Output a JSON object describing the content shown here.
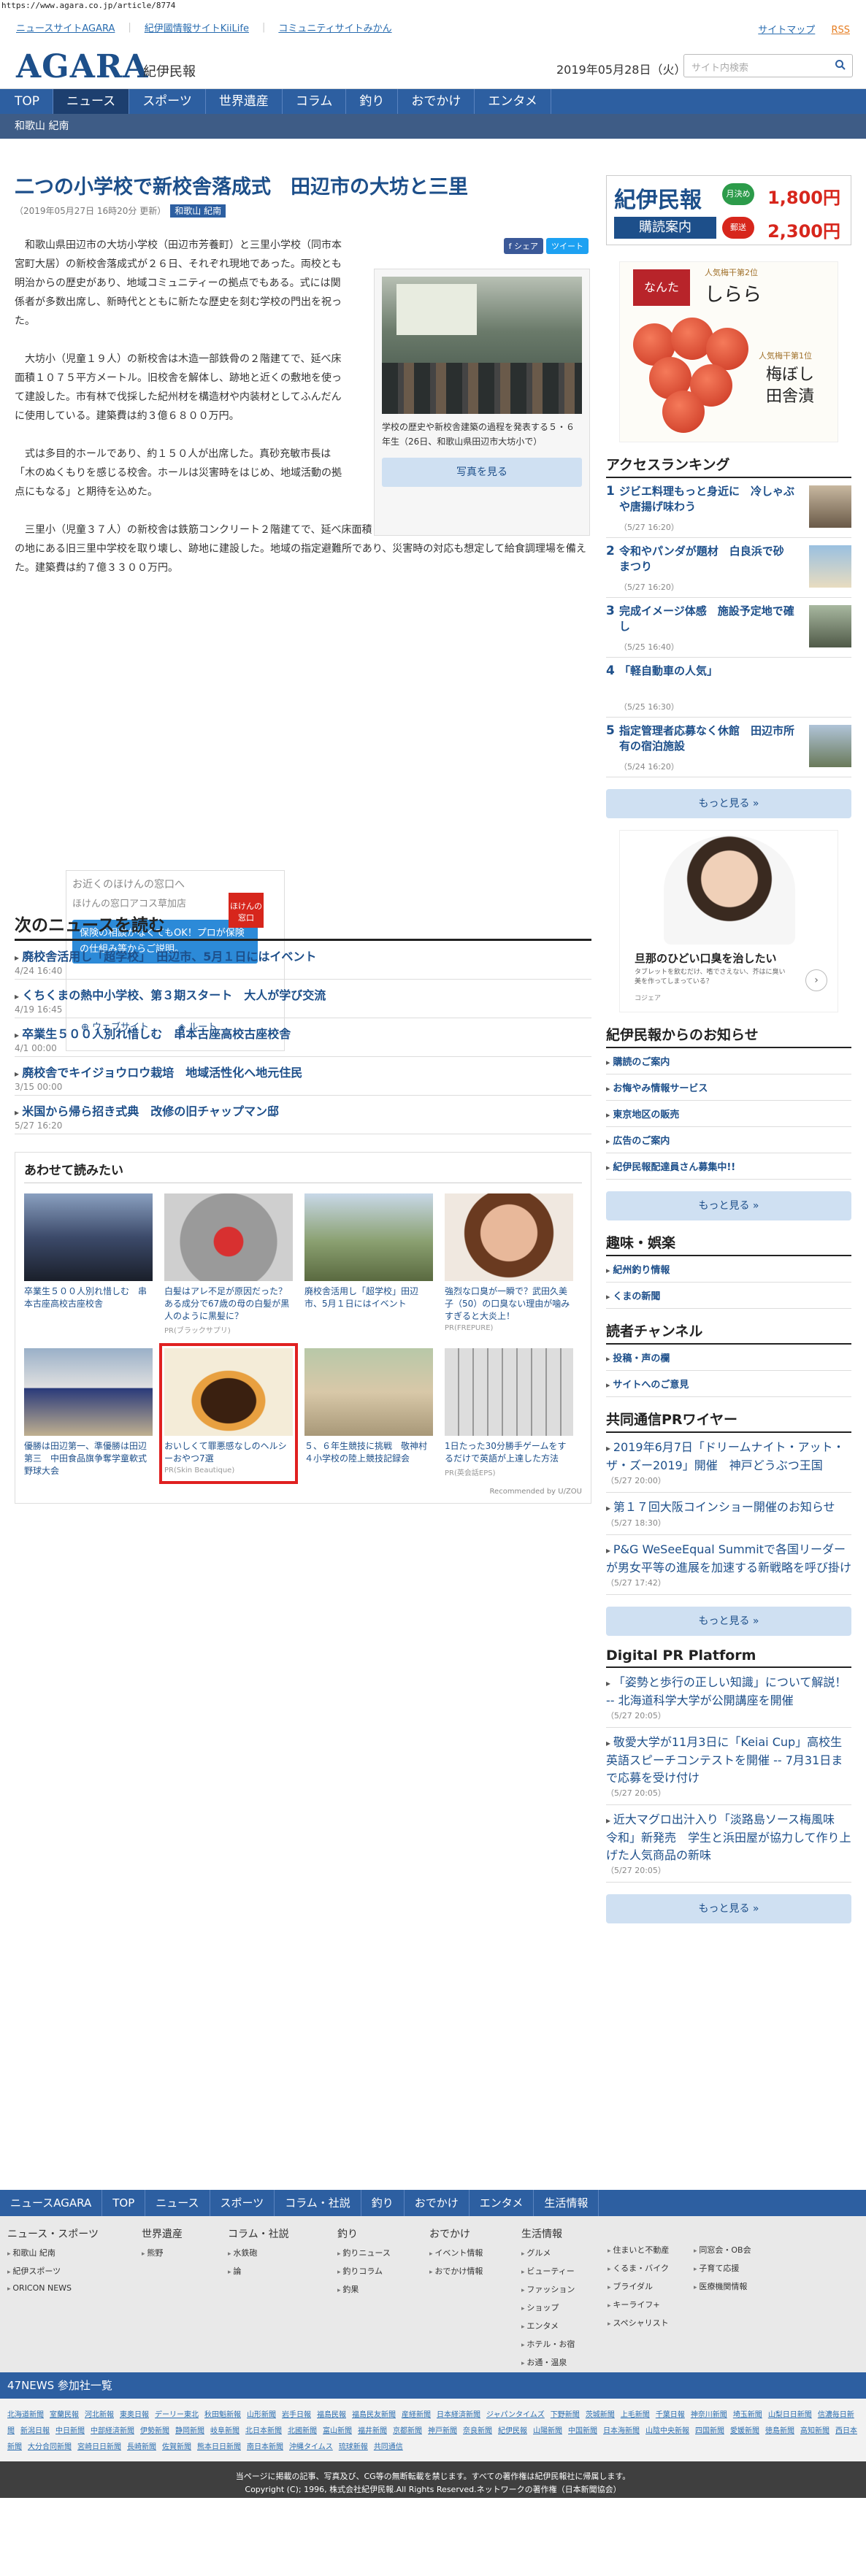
{
  "url": "https://www.agara.co.jp/article/8774",
  "toplinks": {
    "left": [
      "ニュースサイトAGARA",
      "紀伊國情報サイトKiiLife",
      "コミュニティサイトみかん"
    ],
    "sitemap": "サイトマップ",
    "rss": "RSS"
  },
  "header": {
    "logo": "AGARA",
    "logo_sub": "紀伊民報",
    "date": "2019年05月28日（火）",
    "search_placeholder": "サイト内検索"
  },
  "nav": [
    "TOP",
    "ニュース",
    "スポーツ",
    "世界遺産",
    "コラム",
    "釣り",
    "おでかけ",
    "エンタメ"
  ],
  "subnav": "和歌山 紀南",
  "article": {
    "title": "二つの小学校で新校舎落成式　田辺市の大坊と三里",
    "meta": "（2019年05月27日 16時20分 更新）",
    "category": "和歌山 紀南",
    "share": [
      "f シェア",
      "ツイート"
    ],
    "photo_caption": "学校の歴史や新校舎建築の過程を発表する５・６年生（26日、和歌山県田辺市大坊小で）",
    "photo_button": "写真を見る",
    "paragraphs": [
      "和歌山県田辺市の大坊小学校（田辺市芳養町）と三里小学校（同市本宮町大居）の新校舎落成式が２６日、それぞれ現地であった。両校とも明治からの歴史があり、地域コミュニティーの拠点でもある。式には関係者が多数出席し、新時代とともに新たな歴史を刻む学校の門出を祝った。",
      "大坊小（児童１９人）の新校舎は木造一部鉄骨の２階建てで、延べ床面積１０７５平方メートル。旧校舎を解体し、跡地と近くの敷地を使って建設した。市有林で伐採した紀州材を構造材や内装材としてふんだんに使用している。建築費は約３億６８００万円。",
      "式は多目的ホールであり、約１５０人が出席した。真砂充敏市長は「木のぬくもりを感じる校舎。ホールは災害時をはじめ、地域活動の拠点にもなる」と期待を込めた。",
      "三里小（児童３７人）の新校舎は鉄筋コンクリート２階建てで、延べ床面積２２０９平方メートル。標高約１００メートルの地にある旧三里中学校を取り壊し、跡地に建設した。地域の指定避難所であり、災害時の対応も想定して給食調理場を備えた。建築費は約７億３３００万円。"
    ]
  },
  "ad1": {
    "line1": "お近くのほけんの窓口へ",
    "line2": "ほけんの窓口アコス草加店",
    "logo": "ほけんの窓口",
    "blue": "保険の相談がなくてもOK！プロが保険の仕組み等からご説明。",
    "actions": [
      "ウェブサイト",
      "ルート"
    ]
  },
  "next": {
    "heading": "次のニュースを読む",
    "items": [
      {
        "title": "廃校舎活用し「超学校」　田辺市、5月１日にはイベント",
        "date": "4/24 16:40"
      },
      {
        "title": "くちくまの熱中小学校、第３期スタート　大人が学び交流",
        "date": "4/19 16:45"
      },
      {
        "title": "卒業生５００人別れ惜しむ　串本古座高校古座校舎",
        "date": "4/1 00:00"
      },
      {
        "title": "廃校舎でキイジョウロウ栽培　地域活性化へ地元住民",
        "date": "3/15 00:00"
      },
      {
        "title": "米国から帰ら招き式典　改修の旧チャップマン邸",
        "date": "5/27 16:20"
      }
    ]
  },
  "related": {
    "heading": "あわせて読みたい",
    "cards": [
      {
        "title": "卒業生５００人別れ惜しむ　串本古座高校古座校舎",
        "pr": ""
      },
      {
        "title": "白髪はアレ不足が原因だった？ある成分で67歳の母の白髪が黒人のように黒髪に？",
        "pr": "PR(ブラックサプリ)"
      },
      {
        "title": "廃校舎活用し「超学校」田辺市、5月１日にはイベント",
        "pr": ""
      },
      {
        "title": "強烈な口臭が一瞬で？武田久美子（50）の口臭ない理由が噛みすぎると大炎上！",
        "pr": "PR(FREPURE)"
      },
      {
        "title": "優勝は田辺第一、準優勝は田辺第三　中田食品旗争奪学童軟式野球大会",
        "pr": ""
      },
      {
        "title": "おいしくて罪悪感なしのヘルシーおやつ7選",
        "pr": "PR(Skin Beautique)"
      },
      {
        "title": "５、６年生競技に挑戦　敬神村４小学校の陸上競技記録会",
        "pr": ""
      },
      {
        "title": "1日たった30分勝手ゲームをするだけで英語が上達した方法",
        "pr": "PR(英会話EPS)"
      }
    ],
    "recommended": "Recommended by U/ZOU"
  },
  "side": {
    "banner": {
      "title": "紀伊民報",
      "sub": "購読案内",
      "b1": "月決め",
      "p1": "1,800円",
      "b2": "郵送",
      "p2": "2,300円"
    },
    "ume": {
      "brand": "なんた",
      "title": "しらら",
      "rank": "人気梅干第2位",
      "rank2": "人気梅干第1位",
      "name": "梅ぼし 田舎漬"
    },
    "ranking_heading": "アクセスランキング",
    "ranking": [
      {
        "n": "1",
        "title": "ジビエ料理もっと身近に　冷しゃぶや唐揚げ味わう",
        "date": "（5/27 16:20）"
      },
      {
        "n": "2",
        "title": "令和やパンダが題材　白良浜で砂まつり",
        "date": "（5/27 16:20）"
      },
      {
        "n": "3",
        "title": "完成イメージ体感　施設予定地で確し",
        "date": "（5/25 16:40）"
      },
      {
        "n": "4",
        "title": "「軽自動車の人気」",
        "date": "（5/25 16:30）"
      },
      {
        "n": "5",
        "title": "指定管理者応募なく休館　田辺市所有の宿泊施設",
        "date": "（5/24 16:20）"
      }
    ],
    "more": "もっと見る »",
    "ad2": {
      "line1": "旦那のひどい口臭を治したい",
      "line2": "タブレットを飲むだけ、嗜でさえない、芥はに臭い美を作ってしまっている？",
      "src": "コジェア"
    },
    "notice_heading": "紀伊民報からのお知らせ",
    "notice": [
      "購読のご案内",
      "お悔やみ情報サービス",
      "東京地区の販売",
      "広告のご案内",
      "紀伊民報配達員さん募集中!!"
    ],
    "hobby_heading": "趣味・娯楽",
    "hobby": [
      "紀州釣り情報",
      "くまの新聞"
    ],
    "reader_heading": "読者チャンネル",
    "reader": [
      "投稿・声の欄",
      "サイトへのご意見"
    ],
    "kyodo_heading": "共同通信PRワイヤー",
    "kyodo": [
      {
        "title": "2019年6月7日「ドリームナイト・アット・ザ・ズー2019」開催　神戸どうぶつ王国",
        "date": "（5/27 20:00）"
      },
      {
        "title": "第１７回大阪コインショー開催のお知らせ",
        "date": "（5/27 18:30）"
      },
      {
        "title": "P&G WeSeeEqual Summitで各国リーダーが男女平等の進展を加速する新戦略を呼び掛け",
        "date": "（5/27 17:42）"
      }
    ],
    "digital_heading": "Digital PR Platform",
    "digital": [
      {
        "title": "「姿勢と歩行の正しい知識」について解説！ -- 北海道科学大学が公開講座を開催",
        "date": "（5/27 20:05）"
      },
      {
        "title": "敬愛大学が11月3日に「Keiai Cup」高校生英語スピーチコンテストを開催 -- 7月31日まで応募を受け付け",
        "date": "（5/27 20:05）"
      },
      {
        "title": "近大マグロ出汁入り「淡路島ソース梅風味　令和」新発売　学生と浜田屋が協力して作り上げた人気商品の新味",
        "date": "（5/27 20:05）"
      }
    ]
  },
  "footer": {
    "nav": [
      "ニュースAGARA",
      "TOP",
      "ニュース",
      "スポーツ",
      "コラム・社説",
      "釣り",
      "おでかけ",
      "エンタメ",
      "生活情報"
    ],
    "cols": [
      {
        "h": "ニュース・スポーツ",
        "items": [
          "和歌山 紀南",
          "紀伊スポーツ",
          "ORICON NEWS"
        ]
      },
      {
        "h": "世界遺産",
        "items": [
          "熊野"
        ]
      },
      {
        "h": "コラム・社説",
        "items": [
          "水鉄砲",
          "論"
        ]
      },
      {
        "h": "釣り",
        "items": [
          "釣りニュース",
          "釣りコラム",
          "釣果"
        ]
      },
      {
        "h": "おでかけ",
        "items": [
          "イベント情報",
          "おでかけ情報"
        ]
      },
      {
        "h": "生活情報",
        "items": [
          "グルメ",
          "ビューティー",
          "ファッション",
          "ショップ",
          "エンタメ",
          "ホテル・お宿",
          "お通・温泉"
        ]
      },
      {
        "h": "",
        "items": [
          "住まいと不動産",
          "くるま・バイク",
          "ブライダル",
          "キーライフ+",
          "スペシャリスト"
        ]
      },
      {
        "h": "",
        "items": [
          "同窓会・OB会",
          "子育て応援",
          "医療機関情報"
        ]
      }
    ],
    "n47": "47NEWS 参加社一覧",
    "n47list": [
      "北海道新聞",
      "室蘭民報",
      "河北新報",
      "東奥日報",
      "デーリー東北",
      "秋田魁新報",
      "山形新聞",
      "岩手日報",
      "福島民報",
      "福島民友新聞",
      "産経新聞",
      "日本経済新聞",
      "ジャパンタイムズ",
      "下野新聞",
      "茨城新聞",
      "上毛新聞",
      "千葉日報",
      "神奈川新聞",
      "埼玉新聞",
      "山梨日日新聞",
      "信濃毎日新聞",
      "新潟日報",
      "中日新聞",
      "中部経済新聞",
      "伊勢新聞",
      "静岡新聞",
      "岐阜新聞",
      "北日本新聞",
      "北國新聞",
      "富山新聞",
      "福井新聞",
      "京都新聞",
      "神戸新聞",
      "奈良新聞",
      "紀伊民報",
      "山陽新聞",
      "中国新聞",
      "日本海新聞",
      "山陰中央新報",
      "四国新聞",
      "愛媛新聞",
      "徳島新聞",
      "高知新聞",
      "西日本新聞",
      "大分合同新聞",
      "宮崎日日新聞",
      "長崎新聞",
      "佐賀新聞",
      "熊本日日新聞",
      "南日本新聞",
      "沖縄タイムス",
      "琉球新報",
      "共同通信"
    ],
    "copy1": "当ページに掲載の記事、写真及び、CG等の無断転載を禁じます。すべての著作権は紀伊民報社に帰属します。",
    "copy2": "Copyright (C); 1996, 株式会社紀伊民報.All Rights Reserved.ネットワークの著作権（日本新聞協会）"
  }
}
